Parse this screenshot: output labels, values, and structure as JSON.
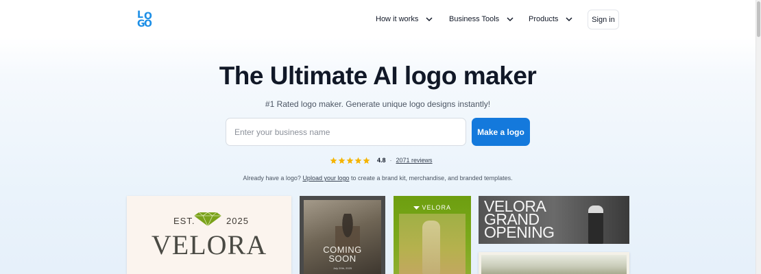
{
  "header": {
    "logo_letters": [
      "L",
      "O",
      "G",
      "O"
    ],
    "nav": [
      {
        "label": "How it works"
      },
      {
        "label": "Business Tools"
      },
      {
        "label": "Products"
      }
    ],
    "signin_label": "Sign in"
  },
  "hero": {
    "title": "The Ultimate AI logo maker",
    "subtitle": "#1 Rated logo maker. Generate unique logo designs instantly!",
    "search_placeholder": "Enter your business name",
    "search_value": "",
    "cta_label": "Make a logo"
  },
  "rating": {
    "stars": 5,
    "score": "4.8",
    "separator": "·",
    "reviews": "2071 reviews"
  },
  "upload_note": {
    "prefix": "Already have a logo?",
    "link": "Upload your logo",
    "suffix": "to create a brand kit, merchandise, and branded templates."
  },
  "gallery": {
    "card1": {
      "est": "EST.",
      "year": "2025",
      "name": "VELORA"
    },
    "card2": {
      "line1": "COMING",
      "line2": "SOON",
      "date": "July 20th, 2025"
    },
    "card3": {
      "logo": "VELORA"
    },
    "card4": {
      "line1": "VELORA",
      "line2": "GRAND",
      "line3": "OPENING"
    }
  },
  "colors": {
    "brand_blue": "#1479dc",
    "logo_blue": "#1d8fe6",
    "star_yellow": "#f5b400",
    "gem_green": "#7aa21a"
  },
  "icons": {
    "nav_chevron": "chevron-down-icon",
    "rating_star": "star-icon",
    "logo": "logo-icon"
  }
}
